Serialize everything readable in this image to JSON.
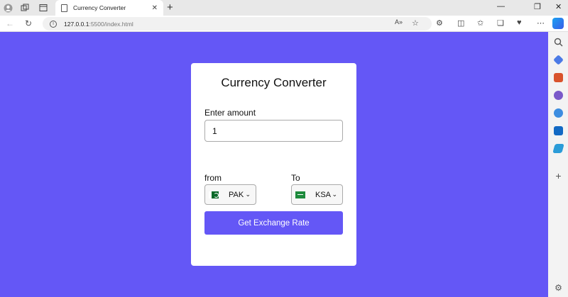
{
  "browser": {
    "tab_title": "Currency Converter",
    "url_host": "127.0.0.1",
    "url_path": ":5500/index.html"
  },
  "app": {
    "title": "Currency Converter",
    "amount_label": "Enter amount",
    "amount_value": "1",
    "from_label": "from",
    "to_label": "To",
    "from_currency": "PAK",
    "to_currency": "KSA",
    "button_label": "Get Exchange Rate"
  },
  "colors": {
    "background": "#6457f6",
    "button": "#6457f6"
  }
}
